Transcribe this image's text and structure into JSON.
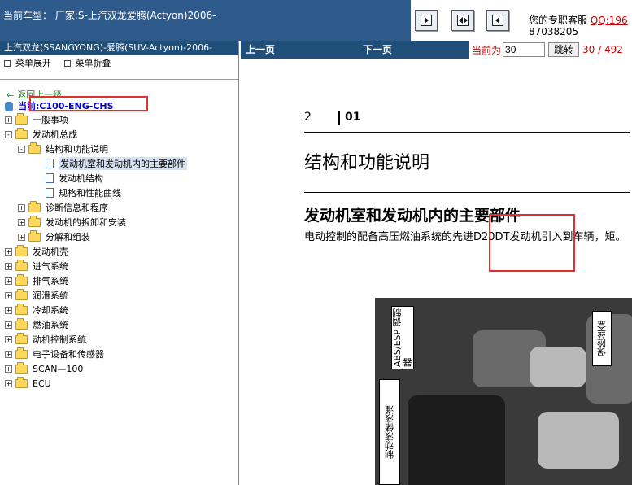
{
  "header": {
    "vehicle_label": "当前车型：",
    "vehicle_value": "厂家:S-上汽双龙爱腾(Actyon)2006-",
    "support_label": "您的专职客服",
    "support_qq": "QQ:196",
    "support_phone": "87038205"
  },
  "sidebar": {
    "title": "上汽双龙(SSANGYONG)-爱腾(SUV-Actyon)-2006-",
    "expand_label": "菜单展开",
    "collapse_label": "菜单折叠",
    "back_label": "返回上一级",
    "current_label": "当前:C100-ENG-CHS",
    "tree": [
      {
        "label": "一般事项",
        "expander": "+",
        "kind": "folder"
      },
      {
        "label": "发动机总成",
        "expander": "-",
        "kind": "folder"
      },
      {
        "label": "结构和功能说明",
        "expander": "-",
        "kind": "folder"
      },
      {
        "label": "发动机室和发动机内的主要部件",
        "expander": "",
        "kind": "doc",
        "selected": true
      },
      {
        "label": "发动机结构",
        "expander": "",
        "kind": "doc"
      },
      {
        "label": "规格和性能曲线",
        "expander": "",
        "kind": "doc"
      },
      {
        "label": "诊断信息和程序",
        "expander": "+",
        "kind": "folder"
      },
      {
        "label": "发动机的拆卸和安装",
        "expander": "+",
        "kind": "folder"
      },
      {
        "label": "分解和组装",
        "expander": "+",
        "kind": "folder"
      },
      {
        "label": "发动机壳",
        "expander": "+",
        "kind": "folder"
      },
      {
        "label": "进气系统",
        "expander": "+",
        "kind": "folder"
      },
      {
        "label": "排气系统",
        "expander": "+",
        "kind": "folder"
      },
      {
        "label": "润滑系统",
        "expander": "+",
        "kind": "folder"
      },
      {
        "label": "冷却系统",
        "expander": "+",
        "kind": "folder"
      },
      {
        "label": "燃油系统",
        "expander": "+",
        "kind": "folder"
      },
      {
        "label": "动机控制系统",
        "expander": "+",
        "kind": "folder"
      },
      {
        "label": "电子设备和传感器",
        "expander": "+",
        "kind": "folder"
      },
      {
        "label": "SCAN—100",
        "expander": "+",
        "kind": "folder"
      },
      {
        "label": "ECU",
        "expander": "+",
        "kind": "folder"
      }
    ]
  },
  "toolbar": {
    "prev_label": "上一页",
    "next_label": "下一页",
    "current_page_label": "当前为",
    "current_page_value": "30",
    "jump_label": "跳转",
    "total_label": "30 / 492"
  },
  "document": {
    "page_number": "2",
    "section_number": "01",
    "title": "结构和功能说明",
    "subtitle": "发动机室和发动机内的主要部件",
    "body_text": "电动控制的配备高压燃油系统的先进D20DT发动机引入到车辆，矩。",
    "callouts": {
      "abs": "ABS/ESP 调制器",
      "fuse": "保险丝盒",
      "brake": "制动液储液灌"
    }
  },
  "colors": {
    "header_bg": "#2e5b8c",
    "toolbar_bg": "#1f4e79",
    "accent_red": "#cc0000",
    "highlight_box": "#e03030"
  }
}
